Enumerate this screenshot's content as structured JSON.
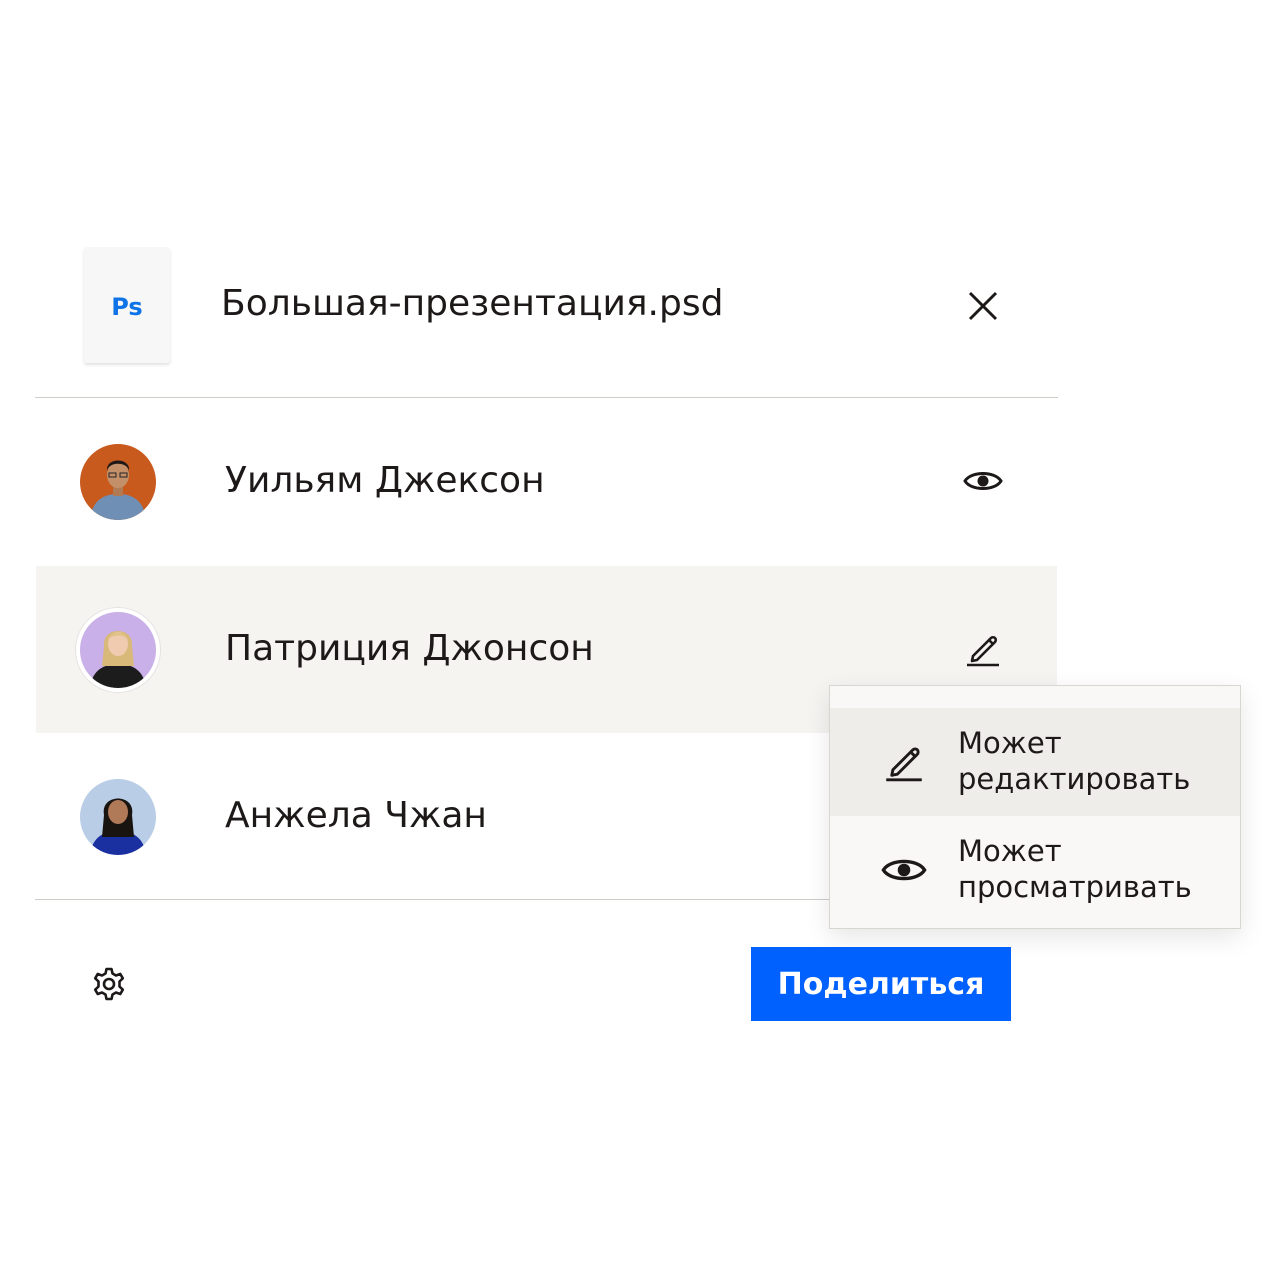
{
  "file": {
    "type_badge": "Ps",
    "name": "Большая-презентация.psd",
    "close_icon": "close-icon"
  },
  "people": [
    {
      "name": "Уильям Джексон",
      "permission_icon": "eye-icon",
      "avatar_color": "#c85a1e"
    },
    {
      "name": "Патриция Джонсон",
      "permission_icon": "pencil-icon",
      "avatar_color": "#c9b0e8",
      "selected": true
    },
    {
      "name": "Анжела Чжан",
      "permission_icon": "",
      "avatar_color": "#b9cde6"
    }
  ],
  "permission_menu": {
    "items": [
      {
        "label": "Может редактировать",
        "icon": "pencil-icon",
        "active": true
      },
      {
        "label": "Может просматривать",
        "icon": "eye-icon",
        "active": false
      }
    ]
  },
  "footer": {
    "settings_icon": "gear-icon",
    "share_label": "Поделиться"
  },
  "colors": {
    "accent": "#0061fe",
    "ps_badge": "#0f73e8",
    "selected_row": "#f5f4f1",
    "menu_active": "#efedea"
  }
}
